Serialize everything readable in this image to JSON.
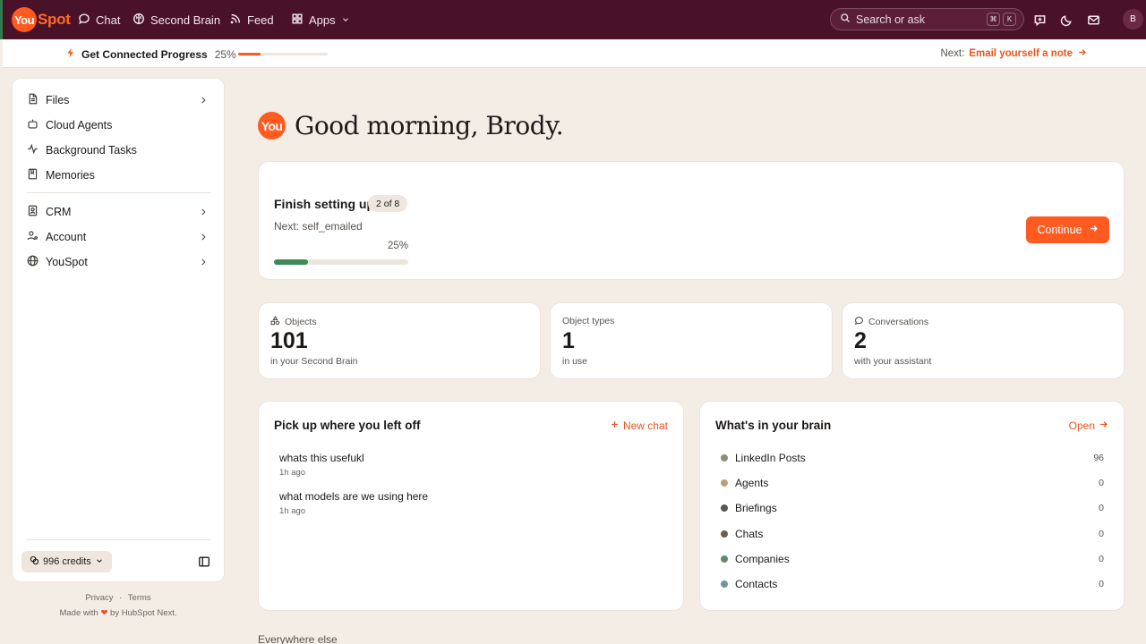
{
  "topnav": {
    "logo_you": "You",
    "logo_spot": "Spot",
    "items": [
      {
        "label": "Chat",
        "icon": "chat-bubble-icon"
      },
      {
        "label": "Second Brain",
        "icon": "brain-icon"
      },
      {
        "label": "Feed",
        "icon": "rss-icon"
      },
      {
        "label": "Apps",
        "icon": "grid-icon"
      }
    ],
    "search_placeholder": "Search or ask",
    "shortcut_keys": [
      "⌘",
      "K"
    ],
    "avatar_initial": "B"
  },
  "progress_strip": {
    "title": "Get Connected Progress",
    "percent_label": "25%",
    "progress": 0.25,
    "next_prefix": "Next:",
    "next_link": "Email yourself a note",
    "accent_color": "#ff5a1f"
  },
  "sidebar": {
    "items_top": [
      {
        "label": "Files",
        "icon": "file-icon",
        "has_chevron": true
      },
      {
        "label": "Cloud Agents",
        "icon": "robot-icon",
        "has_chevron": false
      },
      {
        "label": "Background Tasks",
        "icon": "activity-icon",
        "has_chevron": false
      },
      {
        "label": "Memories",
        "icon": "book-icon",
        "has_chevron": false
      }
    ],
    "items_bottom": [
      {
        "label": "CRM",
        "icon": "contact-book-icon",
        "has_chevron": true
      },
      {
        "label": "Account",
        "icon": "user-settings-icon",
        "has_chevron": true
      },
      {
        "label": "YouSpot",
        "icon": "globe-icon",
        "has_chevron": true
      }
    ],
    "credits_label": "996 credits",
    "footer_privacy": "Privacy",
    "footer_sep": "·",
    "footer_terms": "Terms",
    "footer_made_prefix": "Made with",
    "footer_made_suffix": "by HubSpot Next."
  },
  "main": {
    "greeting": "Good morning, Brody.",
    "greeting_logo": "You",
    "setup": {
      "title": "Finish setting up",
      "badge": "2 of 8",
      "next": "Next: self_emailed",
      "percent_label": "25%",
      "progress": 0.25,
      "button_label": "Continue",
      "bar_color": "#3d8a57"
    },
    "stats": [
      {
        "label": "Objects",
        "value": "101",
        "sub": "in your Second Brain",
        "icon": "shapes-icon"
      },
      {
        "label": "Object types",
        "value": "1",
        "sub": "in use",
        "icon": ""
      },
      {
        "label": "Conversations",
        "value": "2",
        "sub": "with your assistant",
        "icon": "chat-bubble-icon"
      }
    ],
    "recent": {
      "title": "Pick up where you left off",
      "action": "New chat",
      "chats": [
        {
          "title": "whats this usefukl",
          "time": "1h ago"
        },
        {
          "title": "what models are we using here",
          "time": "1h ago"
        }
      ]
    },
    "brain": {
      "title": "What's in your brain",
      "action": "Open",
      "rows": [
        {
          "label": "LinkedIn Posts",
          "count": "96",
          "color": "#8a8f7a"
        },
        {
          "label": "Agents",
          "count": "0",
          "color": "#b59f7c"
        },
        {
          "label": "Briefings",
          "count": "0",
          "color": "#5a5753"
        },
        {
          "label": "Chats",
          "count": "0",
          "color": "#6b5d4f"
        },
        {
          "label": "Companies",
          "count": "0",
          "color": "#5e8a6a"
        },
        {
          "label": "Contacts",
          "count": "0",
          "color": "#6e9597"
        }
      ]
    },
    "everywhere_heading": "Everywhere else"
  }
}
